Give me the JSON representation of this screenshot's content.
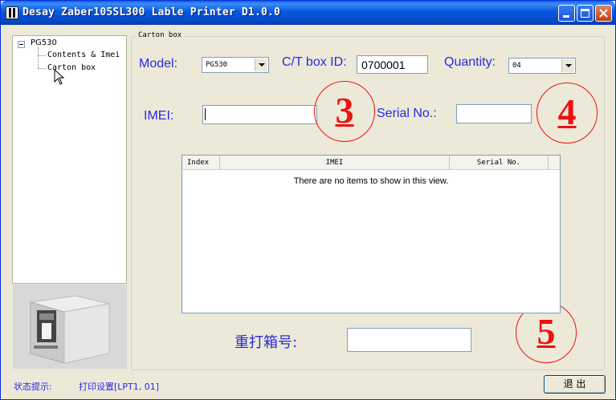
{
  "window": {
    "title": "Desay Zaber105SL300 Lable Printer D1.0.0"
  },
  "sidebar": {
    "root": "PG530",
    "items": [
      {
        "label": "Contents & Imei"
      },
      {
        "label": "Carton box",
        "selected": true
      }
    ]
  },
  "group": {
    "title": "Carton box"
  },
  "form": {
    "model_label": "Model:",
    "model_value": "PG530",
    "ct_box_label": "C/T box ID:",
    "ct_box_value": "0700001",
    "quantity_label": "Quantity:",
    "quantity_value": "04",
    "imei_label": "IMEI:",
    "imei_value": "",
    "serial_label": "Serial No.:",
    "serial_value": ""
  },
  "annotations": [
    "3",
    "4",
    "5"
  ],
  "list": {
    "columns": [
      "Index",
      "IMEI",
      "Serial No."
    ],
    "empty_text": "There are no items to show in this view."
  },
  "reprint": {
    "label": "重打箱号:",
    "value": ""
  },
  "status": {
    "label": "状态提示:",
    "text": "打印设置[LPT1, 01]"
  },
  "exit_button": "退 出",
  "colors": {
    "label_blue": "#2a2ae0",
    "annotation_red": "#e11111",
    "window_bg": "#ece9d8",
    "titlebar_blue": "#0858e0"
  },
  "icons": [
    "app-icon",
    "minimize-icon",
    "maximize-icon",
    "close-icon",
    "tree-expander-icon",
    "combo-arrow-icon",
    "mouse-cursor-icon",
    "printer-image"
  ]
}
